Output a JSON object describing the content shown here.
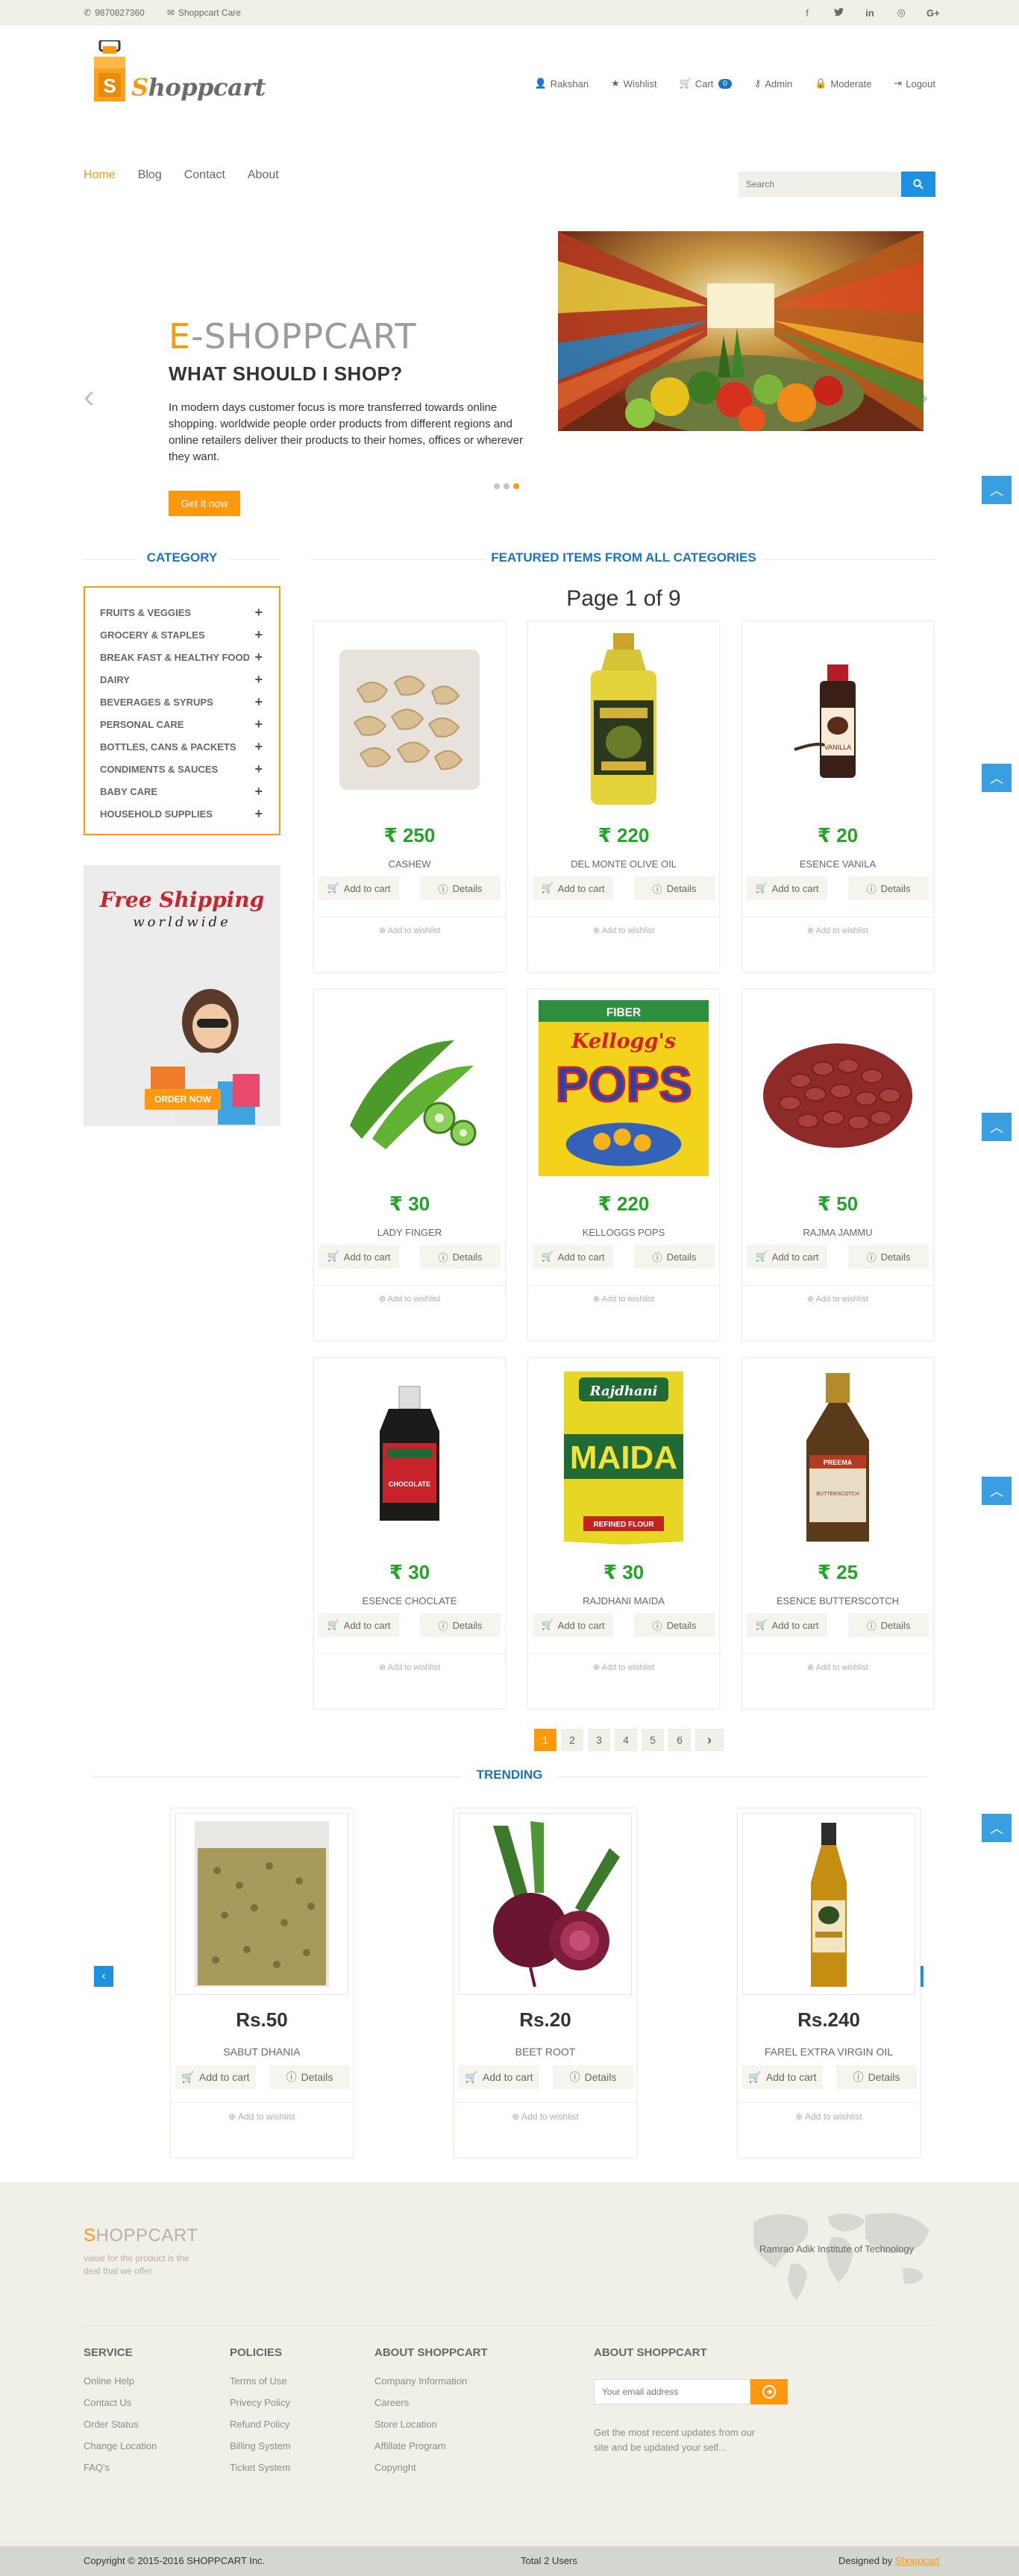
{
  "topbar": {
    "phone": "9870827360",
    "care": "Shoppcart Care",
    "social_icons": [
      "facebook-icon",
      "twitter-icon",
      "linkedin-icon",
      "dribbble-icon",
      "google-plus-icon"
    ]
  },
  "header": {
    "logo_letter": "S",
    "logo_first": "S",
    "logo_rest": "hoppcart",
    "menu": [
      {
        "label": "Rakshan",
        "icon": "user-icon"
      },
      {
        "label": "Wishlist",
        "icon": "star-icon"
      },
      {
        "label": "Cart",
        "icon": "cart-icon",
        "badge": "0"
      },
      {
        "label": "Admin",
        "icon": "key-icon"
      },
      {
        "label": "Moderate",
        "icon": "lock-icon"
      },
      {
        "label": "Logout",
        "icon": "logout-icon"
      }
    ]
  },
  "nav": {
    "items": [
      "Home",
      "Blog",
      "Contact",
      "About"
    ],
    "active": "Home",
    "search_placeholder": "Search"
  },
  "slider": {
    "title_first": "E",
    "title_rest": "-SHOPPCART",
    "subtitle": "WHAT SHOULD I SHOP?",
    "text": "In modern days customer focus is more transferred towards online shopping. worldwide people order products from different regions and online retailers deliver their products to their homes, offices or wherever they want.",
    "button": "Get it now",
    "active_slide": 3,
    "total_slides": 3
  },
  "category": {
    "title": "CATEGORY",
    "items": [
      "FRUITS & VEGGIES",
      "GROCERY & STAPLES",
      "BREAK FAST & HEALTHY FOOD",
      "DAIRY",
      "BEVERAGES & SYRUPS",
      "PERSONAL CARE",
      "BOTTLES, CANS & PACKETS",
      "CONDIMENTS & SAUCES",
      "BABY CARE",
      "HOUSEHOLD SUPPLIES"
    ]
  },
  "ad": {
    "line1": "Free Shipping",
    "line2": "worldwide",
    "button": "ORDER NOW"
  },
  "featured": {
    "title": "FEATURED ITEMS FROM ALL CATEGORIES",
    "page_label": "Page 1 of 9",
    "add_to_cart": "Add to cart",
    "details": "Details",
    "wishlist": "Add to wishlist",
    "products": [
      {
        "price": "₹ 250",
        "name": "CASHEW"
      },
      {
        "price": "₹ 220",
        "name": "DEL MONTE OLIVE OIL"
      },
      {
        "price": "₹ 20",
        "name": "ESENCE VANILA"
      },
      {
        "price": "₹ 30",
        "name": "LADY FINGER"
      },
      {
        "price": "₹ 220",
        "name": "KELLOGGS POPS"
      },
      {
        "price": "₹ 50",
        "name": "RAJMA JAMMU"
      },
      {
        "price": "₹ 30",
        "name": "ESENCE CHOCLATE"
      },
      {
        "price": "₹ 30",
        "name": "RAJDHANI MAIDA"
      },
      {
        "price": "₹ 25",
        "name": "ESENCE BUTTERSCOTCH"
      }
    ],
    "pages": [
      "1",
      "2",
      "3",
      "4",
      "5",
      "6"
    ],
    "current_page": "1"
  },
  "trending": {
    "title": "TRENDING",
    "products": [
      {
        "price": "Rs.50",
        "name": "SABUT DHANIA"
      },
      {
        "price": "Rs.20",
        "name": "BEET ROOT"
      },
      {
        "price": "Rs.240",
        "name": "FAREL EXTRA VIRGIN OIL"
      }
    ]
  },
  "footer": {
    "brand_first": "S",
    "brand_rest": "HOPPCART",
    "tagline": "value for the product is the deal that we offer",
    "map_caption": "Ramrao Adik Institute of Technology",
    "columns": [
      {
        "title": "SERVICE",
        "links": [
          "Online Help",
          "Contact Us",
          "Order Status",
          "Change Location",
          "FAQ's"
        ]
      },
      {
        "title": "POLICIES",
        "links": [
          "Terms of Use",
          "Privecy Policy",
          "Refund Policy",
          "Billing System",
          "Ticket System"
        ]
      },
      {
        "title": "ABOUT SHOPPCART",
        "links": [
          "Company Information",
          "Careers",
          "Store Location",
          "Affillate Program",
          "Copyright"
        ]
      }
    ],
    "subscribe_title": "ABOUT SHOPPCART",
    "email_placeholder": "Your email address",
    "subscribe_note": "Get the most recent updates from our site and be updated your self...",
    "copyright": "Copyright © 2015-2016 SHOPPCART Inc.",
    "users": "Total 2 Users",
    "designed_by": "Designed by",
    "designer": "Shoppcart"
  }
}
